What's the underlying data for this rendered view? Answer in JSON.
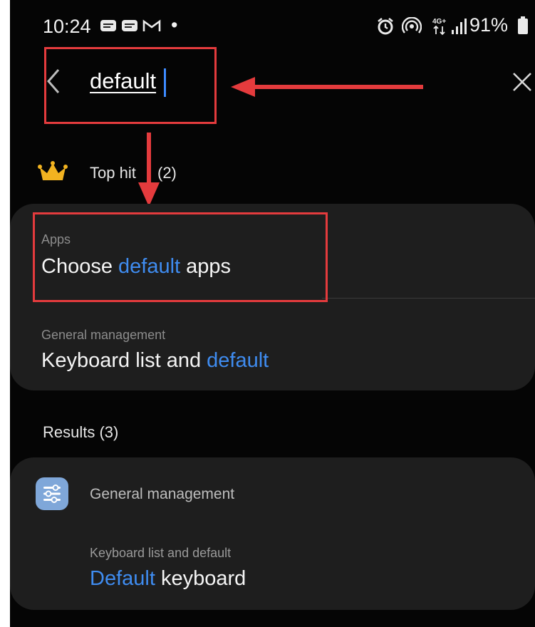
{
  "status_bar": {
    "time": "10:24",
    "battery": "91%",
    "dot": "•",
    "left_icons": [
      "message-icon",
      "message-icon",
      "gmail-icon"
    ],
    "right_icons": [
      "alarm-icon",
      "hotspot-icon",
      "4g-icon",
      "signal-icon",
      "battery-icon"
    ]
  },
  "search": {
    "query": "default"
  },
  "top_hits": {
    "label": "Top hit",
    "count": "(2)",
    "items": [
      {
        "category": "Apps",
        "title_pre": "Choose ",
        "title_hl": "default",
        "title_post": " apps"
      },
      {
        "category": "General management",
        "title_pre": "Keyboard list and ",
        "title_hl": "default",
        "title_post": ""
      }
    ]
  },
  "results": {
    "label": "Results (3)",
    "group_label": "General management",
    "item": {
      "subtitle": "Keyboard list and default",
      "title_hl": "Default",
      "title_post": " keyboard"
    }
  },
  "colors": {
    "accent_blue": "#3f8cf0",
    "annotation_red": "#e43b3d",
    "card_bg": "#1e1e1e",
    "crown_gold": "#f2b320"
  }
}
